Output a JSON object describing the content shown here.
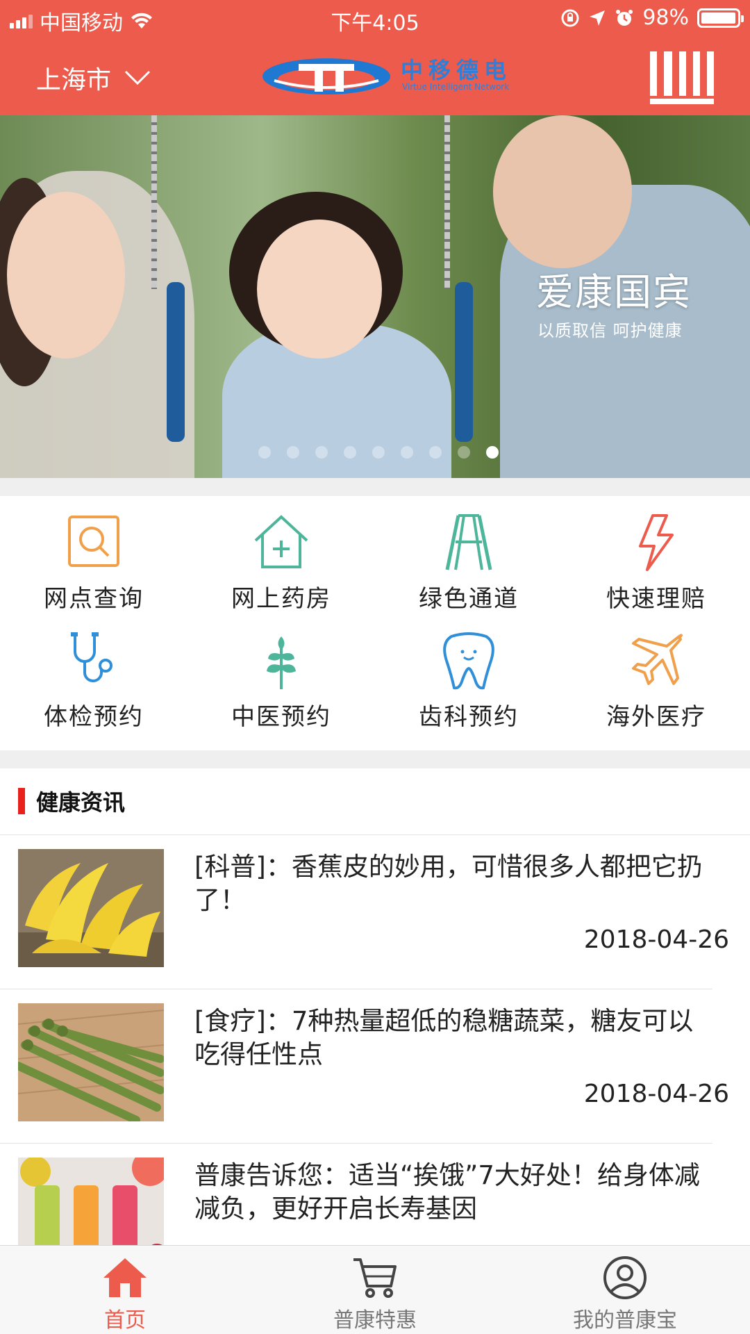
{
  "status_bar": {
    "carrier": "中国移动",
    "time": "下午4:05",
    "battery": "98%",
    "battery_level": 0.98
  },
  "header": {
    "city": "上海市",
    "logo_text": "中移德电",
    "logo_subtitle": "Virtue Intelligent Network"
  },
  "banner": {
    "title": "爱康国宾",
    "subtitle": "以质取信  呵护健康",
    "slide_count": 9,
    "active_slide": 9
  },
  "services": [
    {
      "label": "网点查询",
      "icon": "search-icon",
      "color": "#f0a04b"
    },
    {
      "label": "网上药房",
      "icon": "pharmacy-icon",
      "color": "#4db59a"
    },
    {
      "label": "绿色通道",
      "icon": "road-icon",
      "color": "#4db59a"
    },
    {
      "label": "快速理赔",
      "icon": "lightning-icon",
      "color": "#ec5b4c"
    },
    {
      "label": "体检预约",
      "icon": "stethoscope-icon",
      "color": "#2f8fd8"
    },
    {
      "label": "中医预约",
      "icon": "herb-icon",
      "color": "#4db59a"
    },
    {
      "label": "齿科预约",
      "icon": "tooth-icon",
      "color": "#2f8fd8"
    },
    {
      "label": "海外医疗",
      "icon": "airplane-icon",
      "color": "#f0a04b"
    }
  ],
  "news": {
    "section_title": "健康资讯",
    "items": [
      {
        "title": "[科普]：香蕉皮的妙用，可惜很多人都把它扔了！",
        "date": "2018-04-26",
        "image": "bananas"
      },
      {
        "title": "[食疗]：7种热量超低的稳糖蔬菜，糖友可以吃得任性点",
        "date": "2018-04-26",
        "image": "asparagus"
      },
      {
        "title": "普康告诉您：适当“挨饿”7大好处！给身体减减负，更好开启长寿基因",
        "date": "",
        "image": "juices"
      }
    ]
  },
  "tabbar": {
    "tabs": [
      {
        "label": "首页",
        "icon": "home-icon",
        "active": true
      },
      {
        "label": "普康特惠",
        "icon": "cart-icon",
        "active": false
      },
      {
        "label": "我的普康宝",
        "icon": "user-icon",
        "active": false
      }
    ]
  },
  "colors": {
    "brand_red": "#ec5b4c",
    "logo_blue": "#2f7fd8",
    "accent_bar": "#e8211c"
  }
}
